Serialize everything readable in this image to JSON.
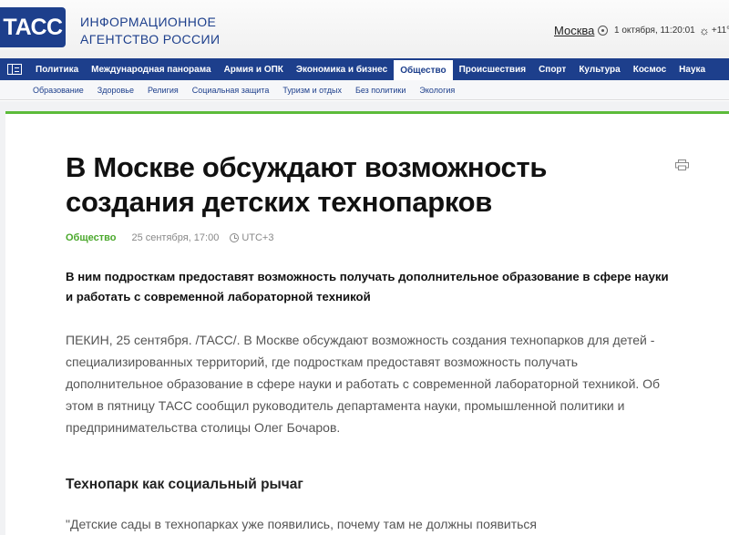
{
  "header": {
    "logo": "ТАСС",
    "agency_line1": "ИНФОРМАЦИОННОЕ",
    "agency_line2": "АГЕНТСТВО РОССИИ",
    "city": "Москва",
    "datetime": "1 октября, 11:20:01",
    "weather": "+11°"
  },
  "nav": {
    "items": [
      {
        "label": "Политика"
      },
      {
        "label": "Международная панорама"
      },
      {
        "label": "Армия и ОПК"
      },
      {
        "label": "Экономика и бизнес"
      },
      {
        "label": "Общество"
      },
      {
        "label": "Происшествия"
      },
      {
        "label": "Спорт"
      },
      {
        "label": "Культура"
      },
      {
        "label": "Космос"
      },
      {
        "label": "Наука"
      }
    ],
    "active": "Общество"
  },
  "subnav": {
    "items": [
      {
        "label": "Образование"
      },
      {
        "label": "Здоровье"
      },
      {
        "label": "Религия"
      },
      {
        "label": "Социальная защита"
      },
      {
        "label": "Туризм и отдых"
      },
      {
        "label": "Без политики"
      },
      {
        "label": "Экология"
      }
    ]
  },
  "article": {
    "title": "В Москве обсуждают возможность создания детских технопарков",
    "rubric": "Общество",
    "date": "25 сентября, 17:00",
    "timezone": "UTC+3",
    "lead": "В ним подросткам предоставят возможность получать дополнительное образование в сфере науки и работать с современной лабораторной техникой",
    "body": "ПЕКИН, 25 сентября. /ТАСС/. В Москве обсуждают возможность создания технопарков для детей - специализированных территорий, где подросткам предоставят возможность получать дополнительное образование в сфере науки и работать с современной лабораторной техникой. Об этом в пятницу ТАСС сообщил руководитель департамента науки, промышленной политики и предпринимательства столицы Олег Бочаров.",
    "subheading": "Технопарк как социальный рычаг",
    "quote_start": "\"Детские сады в технопарках уже появились, почему там не должны появиться"
  },
  "colors": {
    "brand": "#1d3f8c",
    "accent_green": "#5cbb3a",
    "rubric_green": "#4aa82b"
  }
}
